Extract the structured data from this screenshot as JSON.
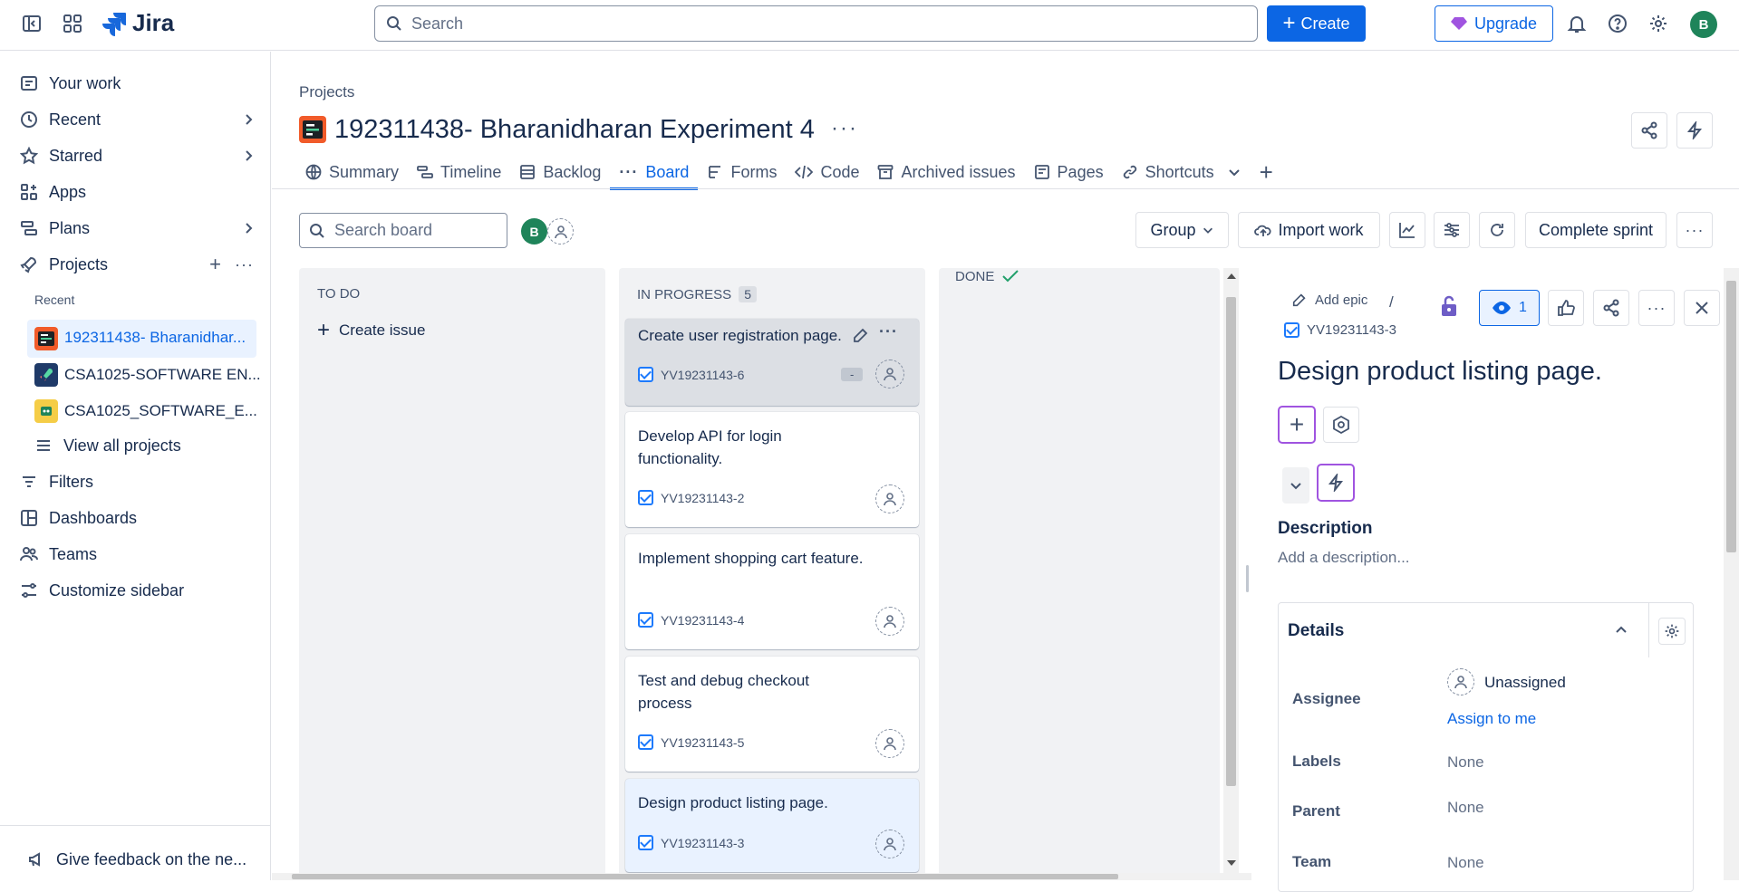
{
  "app": {
    "name": "Jira"
  },
  "header": {
    "search_placeholder": "Search",
    "create_label": "Create",
    "upgrade_label": "Upgrade",
    "avatar_initial": "B"
  },
  "sidebar": {
    "your_work": "Your work",
    "recent": "Recent",
    "starred": "Starred",
    "apps": "Apps",
    "plans": "Plans",
    "projects": "Projects",
    "recent_section": "Recent",
    "recent_projects": [
      "192311438- Bharanidhar...",
      "CSA1025-SOFTWARE EN...",
      "CSA1025_SOFTWARE_E..."
    ],
    "view_all": "View all projects",
    "filters": "Filters",
    "dashboards": "Dashboards",
    "teams": "Teams",
    "customize": "Customize sidebar",
    "feedback": "Give feedback on the ne..."
  },
  "project": {
    "breadcrumb": "Projects",
    "title": "192311438- Bharanidharan Experiment 4",
    "tabs": [
      "Summary",
      "Timeline",
      "Backlog",
      "Board",
      "Forms",
      "Code",
      "Archived issues",
      "Pages",
      "Shortcuts"
    ]
  },
  "board": {
    "search_placeholder": "Search board",
    "avatar_initial": "B",
    "group_label": "Group",
    "import_label": "Import work",
    "complete_sprint": "Complete sprint",
    "columns": {
      "todo": {
        "label": "TO DO",
        "create": "Create issue"
      },
      "inprogress": {
        "label": "IN PROGRESS",
        "count": "5"
      },
      "done": {
        "label": "DONE"
      }
    },
    "cards": [
      {
        "title": "Create user registration page.",
        "key": "YV19231143-6",
        "badge": "-"
      },
      {
        "title": "Develop API for login functionality.",
        "key": "YV19231143-2"
      },
      {
        "title": "Implement shopping cart feature.",
        "key": "YV19231143-4"
      },
      {
        "title": "Test and debug checkout process",
        "key": "YV19231143-5"
      },
      {
        "title": "Design product listing page.",
        "key": "YV19231143-3"
      }
    ]
  },
  "issue": {
    "add_epic": "Add epic",
    "separator": "/",
    "key": "YV19231143-3",
    "watch_count": "1",
    "title": "Design product listing page.",
    "description_label": "Description",
    "description_placeholder": "Add a description...",
    "details_label": "Details",
    "assignee_label": "Assignee",
    "assignee_value": "Unassigned",
    "assign_to_me": "Assign to me",
    "labels_label": "Labels",
    "labels_value": "None",
    "parent_label": "Parent",
    "parent_value": "None",
    "team_label": "Team",
    "team_value": "None"
  }
}
